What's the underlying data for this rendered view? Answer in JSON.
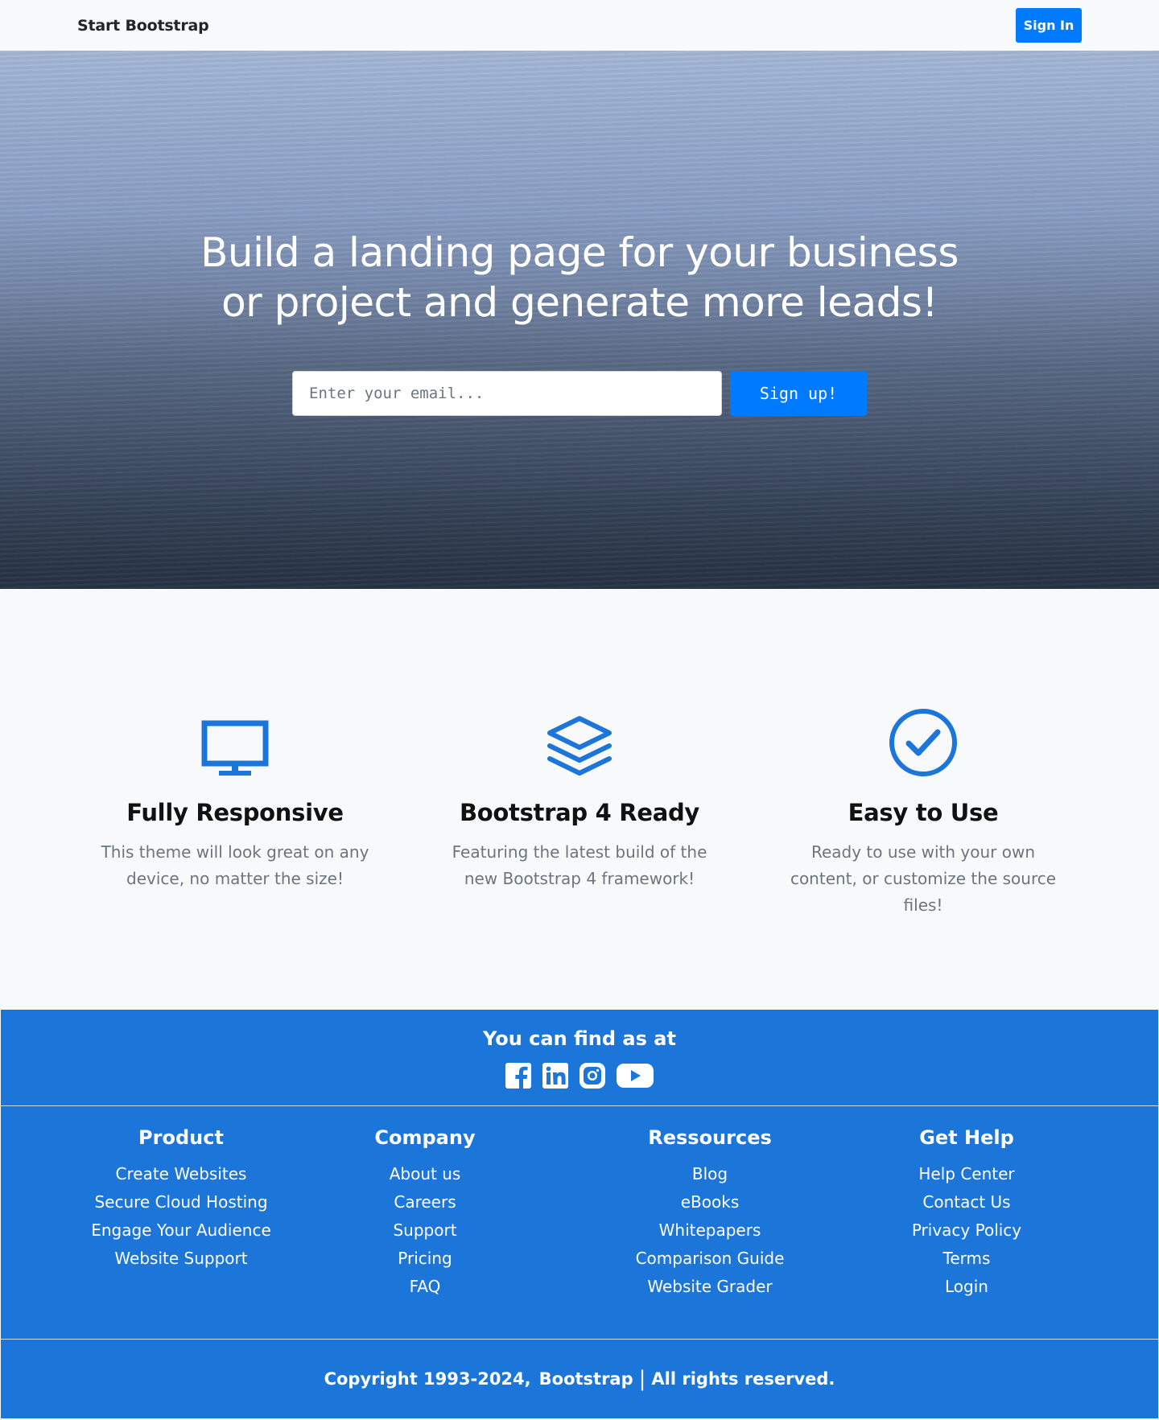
{
  "navbar": {
    "brand": "Start Bootstrap",
    "signin_label": "Sign In"
  },
  "hero": {
    "title_line1": "Build a landing page for your business",
    "title_line2": "or project and generate more leads!",
    "email_placeholder": "Enter your email...",
    "signup_label": "Sign up!"
  },
  "features": [
    {
      "icon": "desktop-monitor-icon",
      "title": "Fully Responsive",
      "text": "This theme will look great on any device, no matter the size!"
    },
    {
      "icon": "layers-icon",
      "title": "Bootstrap 4 Ready",
      "text": "Featuring the latest build of the new Bootstrap 4 framework!"
    },
    {
      "icon": "check-circle-icon",
      "title": "Easy to Use",
      "text": "Ready to use with your own content, or customize the source files!"
    }
  ],
  "footer": {
    "find_us_title": "You can find as at",
    "socials": [
      "facebook-icon",
      "linkedin-icon",
      "instagram-icon",
      "youtube-icon"
    ],
    "columns": [
      {
        "title": "Product",
        "links": [
          "Create Websites",
          "Secure Cloud Hosting",
          "Engage Your Audience",
          "Website Support"
        ]
      },
      {
        "title": "Company",
        "links": [
          "About us",
          "Careers",
          "Support",
          "Pricing",
          "FAQ"
        ]
      },
      {
        "title": "Ressources",
        "links": [
          "Blog",
          "eBooks",
          "Whitepapers",
          "Comparison Guide",
          "Website Grader"
        ]
      },
      {
        "title": "Get Help",
        "links": [
          "Help Center",
          "Contact Us",
          "Privacy Policy",
          "Terms",
          "Login"
        ]
      }
    ],
    "copyright_text": "Copyright 1993-2024,",
    "copyright_brand": "Bootstrap",
    "copyright_separator": "|",
    "copyright_rights": "All rights reserved."
  },
  "colors": {
    "accent": "#007bff",
    "footer_bg": "#1c75d8",
    "icon_blue": "#1c75d8"
  }
}
